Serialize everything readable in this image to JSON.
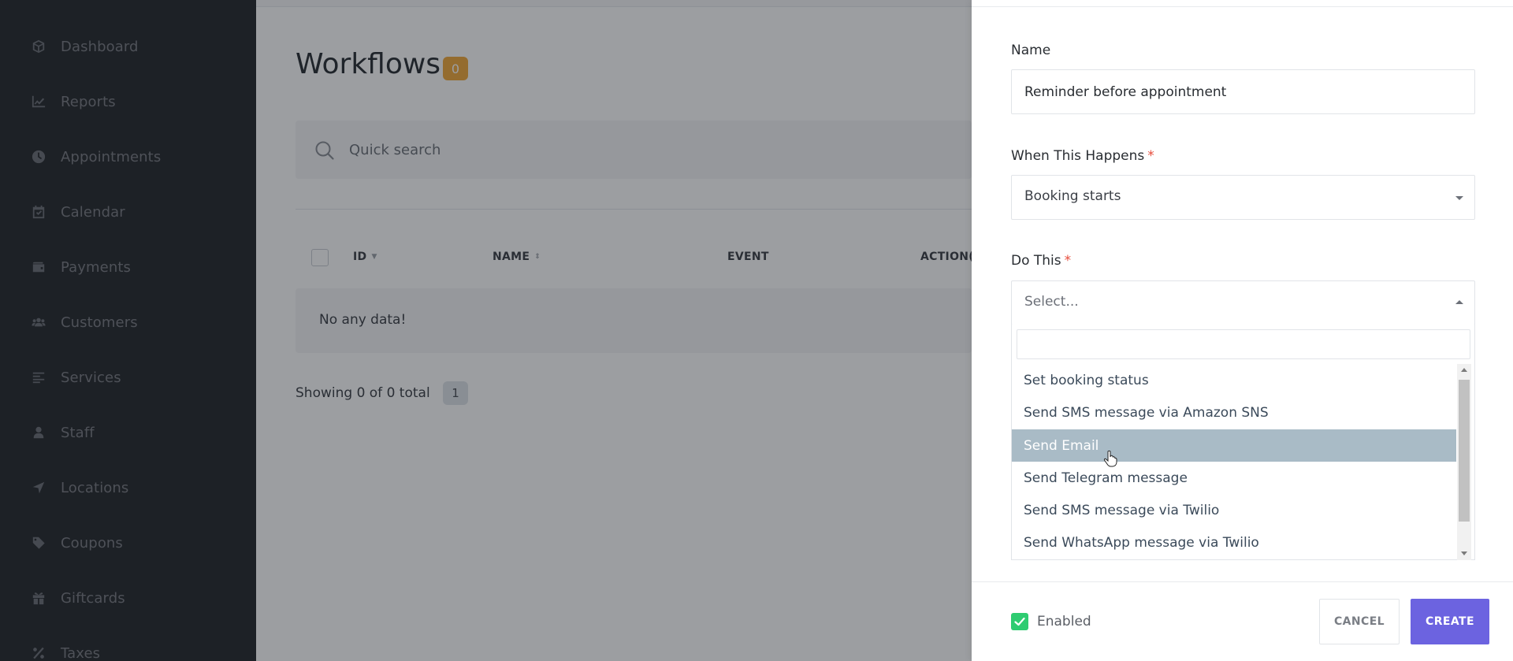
{
  "sidebar": {
    "items": [
      {
        "label": "Dashboard",
        "icon": "cube-icon"
      },
      {
        "label": "Reports",
        "icon": "chart-line-icon"
      },
      {
        "label": "Appointments",
        "icon": "clock-icon"
      },
      {
        "label": "Calendar",
        "icon": "calendar-check-icon"
      },
      {
        "label": "Payments",
        "icon": "wallet-icon"
      },
      {
        "label": "Customers",
        "icon": "users-icon"
      },
      {
        "label": "Services",
        "icon": "align-left-icon"
      },
      {
        "label": "Staff",
        "icon": "user-icon"
      },
      {
        "label": "Locations",
        "icon": "location-arrow-icon"
      },
      {
        "label": "Coupons",
        "icon": "tag-icon"
      },
      {
        "label": "Giftcards",
        "icon": "gift-icon"
      },
      {
        "label": "Taxes",
        "icon": "percent-icon"
      }
    ]
  },
  "main": {
    "title": "Workflows",
    "count": "0",
    "search_placeholder": "Quick search",
    "table": {
      "columns": [
        "ID",
        "NAME",
        "EVENT",
        "ACTION("
      ],
      "empty_text": "No any data!"
    },
    "footer_text": "Showing 0 of 0 total",
    "page": "1"
  },
  "panel": {
    "name_label": "Name",
    "name_value": "Reminder before appointment",
    "when_label": "When This Happens",
    "when_value": "Booking starts",
    "do_label": "Do This",
    "do_placeholder": "Select...",
    "required_mark": "*",
    "options": [
      "Set booking status",
      "Send SMS message via Amazon SNS",
      "Send Email",
      "Send Telegram message",
      "Send SMS message via Twilio",
      "Send WhatsApp message via Twilio"
    ],
    "highlighted_option": "Send Email",
    "enabled_label": "Enabled",
    "enabled": true,
    "cancel_label": "CANCEL",
    "create_label": "CREATE"
  },
  "colors": {
    "sidebar_bg": "#2b2e33",
    "accent": "#6c63e0",
    "badge": "#f2a93b",
    "highlight": "#a9bbc6",
    "checkbox": "#2ecc71",
    "required": "#e74c3c"
  }
}
